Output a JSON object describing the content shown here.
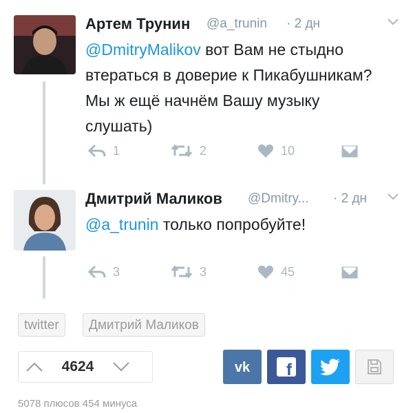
{
  "tweets": [
    {
      "author": "Артем Трунин",
      "handle": "@a_trunin",
      "time": "· 2 дн",
      "text_mention": "@DmitryMalikov",
      "text_body": " вот Вам не стыдно втераться в доверие к Пикабушникам? Мы ж ещё начнём Вашу музыку слушать)",
      "replies": "1",
      "retweets": "2",
      "likes": "10"
    },
    {
      "author": "Дмитрий Маликов",
      "handle": "@Dmitry...",
      "time": "· 2 дн",
      "text_mention": "@a_trunin",
      "text_body": " только попробуйте!",
      "replies": "3",
      "retweets": "3",
      "likes": "45"
    }
  ],
  "tags": [
    "twitter",
    "Дмитрий Маликов"
  ],
  "rating": {
    "score": "4624",
    "stats": "5078 плюсов 454 минуса"
  },
  "share": [
    {
      "icon": "vk-icon",
      "label": "vk",
      "color": "#4a76a8"
    },
    {
      "icon": "facebook-icon",
      "label": "f",
      "color": "#3b5998"
    },
    {
      "icon": "twitter-bird-icon",
      "label": "",
      "color": "#1da1f2"
    },
    {
      "icon": "save-icon",
      "label": "",
      "color": "#f3f3f3"
    }
  ],
  "colors": {
    "mention": "#1b95e0",
    "muted": "#8899a6",
    "icon": "#aab8c2"
  }
}
